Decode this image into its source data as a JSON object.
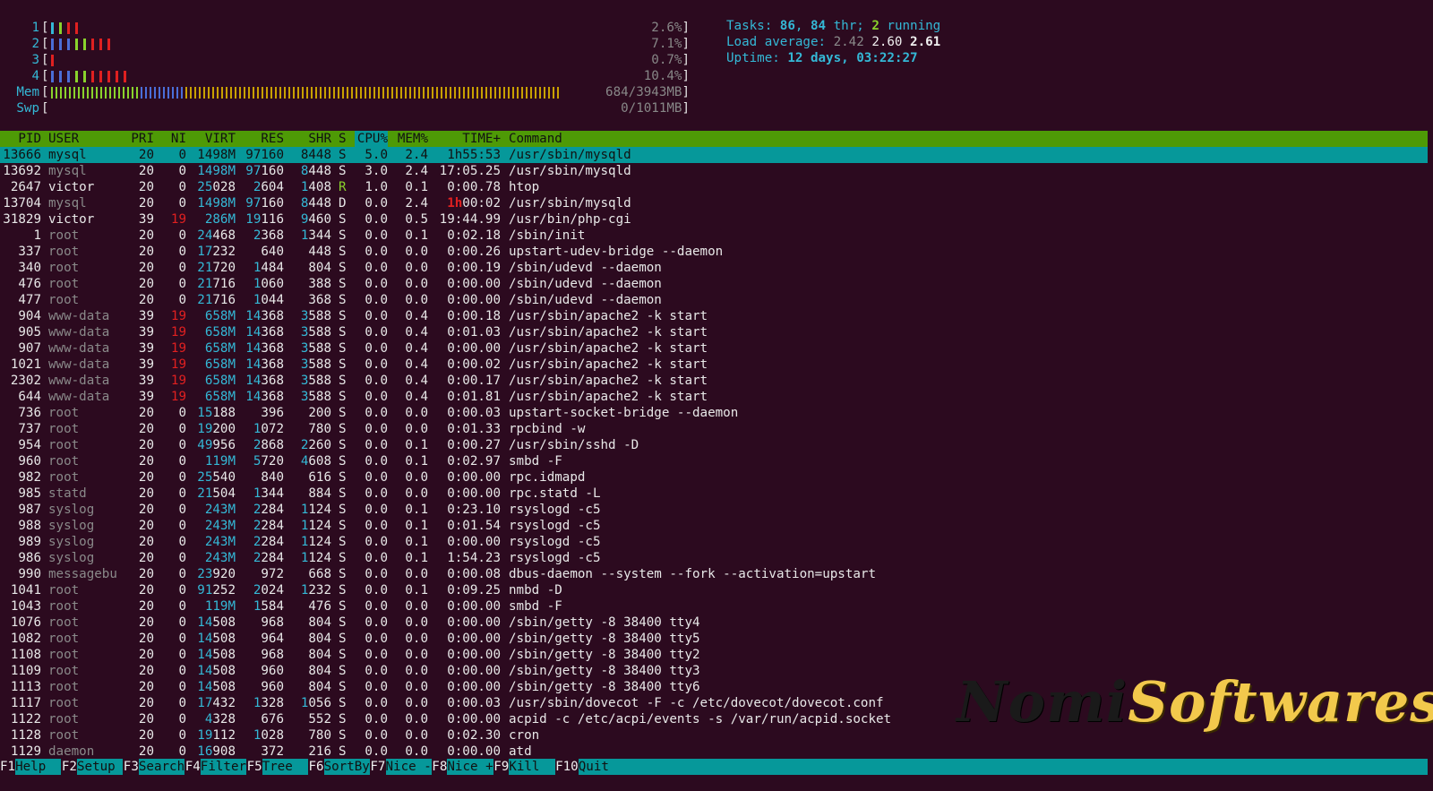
{
  "meters": {
    "cpu": [
      {
        "label": "1",
        "value": "2.6%]",
        "bars": [
          {
            "c": "#34b8d6"
          },
          {
            "c": "#8ad32c"
          },
          {
            "c": "#e02020"
          },
          {
            "c": "#e02020"
          }
        ]
      },
      {
        "label": "2",
        "value": "7.1%]",
        "bars": [
          {
            "c": "#4a6ed8"
          },
          {
            "c": "#4a6ed8"
          },
          {
            "c": "#4a6ed8"
          },
          {
            "c": "#8ad32c"
          },
          {
            "c": "#8ad32c"
          },
          {
            "c": "#e02020"
          },
          {
            "c": "#e02020"
          },
          {
            "c": "#e02020"
          }
        ]
      },
      {
        "label": "3",
        "value": "0.7%]",
        "bars": [
          {
            "c": "#e02020"
          }
        ]
      },
      {
        "label": "4",
        "value": "10.4%]",
        "bars": [
          {
            "c": "#4a6ed8"
          },
          {
            "c": "#4a6ed8"
          },
          {
            "c": "#4a6ed8"
          },
          {
            "c": "#8ad32c"
          },
          {
            "c": "#8ad32c"
          },
          {
            "c": "#e02020"
          },
          {
            "c": "#e02020"
          },
          {
            "c": "#e02020"
          },
          {
            "c": "#e02020"
          },
          {
            "c": "#e02020"
          }
        ]
      }
    ],
    "mem": {
      "label": "Mem",
      "value": "684/3943MB]"
    },
    "swp": {
      "label": "Swp",
      "value": "0/1011MB]"
    }
  },
  "info": {
    "tasks_label": "Tasks: ",
    "tasks": "86",
    "sep1": ", ",
    "thr": "84",
    "thr_label": " thr; ",
    "running": "2",
    "running_label": " running",
    "load_label": "Load average: ",
    "load1": "2.42",
    "load5": "2.60",
    "load15": "2.61",
    "uptime_label": "Uptime: ",
    "uptime": "12 days, 03:22:27"
  },
  "columns": [
    "PID",
    "USER",
    "PRI",
    "NI",
    "VIRT",
    "RES",
    "SHR",
    "S",
    "CPU%",
    "MEM%",
    "TIME+",
    "Command"
  ],
  "processes": [
    [
      "13666",
      "mysql",
      "20",
      "0",
      "1498M",
      "97160",
      "8448",
      "S",
      "5.0",
      "2.4",
      "1h55:53",
      "/usr/sbin/mysqld"
    ],
    [
      "13692",
      "mysql",
      "20",
      "0",
      "1498M",
      "97160",
      "8448",
      "S",
      "3.0",
      "2.4",
      "17:05.25",
      "/usr/sbin/mysqld"
    ],
    [
      "2647",
      "victor",
      "20",
      "0",
      "25028",
      "2604",
      "1408",
      "R",
      "1.0",
      "0.1",
      "0:00.78",
      "htop"
    ],
    [
      "13704",
      "mysql",
      "20",
      "0",
      "1498M",
      "97160",
      "8448",
      "D",
      "0.0",
      "2.4",
      "1h00:02",
      "/usr/sbin/mysqld"
    ],
    [
      "31829",
      "victor",
      "39",
      "19",
      "286M",
      "19116",
      "9460",
      "S",
      "0.0",
      "0.5",
      "19:44.99",
      "/usr/bin/php-cgi"
    ],
    [
      "1",
      "root",
      "20",
      "0",
      "24468",
      "2368",
      "1344",
      "S",
      "0.0",
      "0.1",
      "0:02.18",
      "/sbin/init"
    ],
    [
      "337",
      "root",
      "20",
      "0",
      "17232",
      "640",
      "448",
      "S",
      "0.0",
      "0.0",
      "0:00.26",
      "upstart-udev-bridge --daemon"
    ],
    [
      "340",
      "root",
      "20",
      "0",
      "21720",
      "1484",
      "804",
      "S",
      "0.0",
      "0.0",
      "0:00.19",
      "/sbin/udevd --daemon"
    ],
    [
      "476",
      "root",
      "20",
      "0",
      "21716",
      "1060",
      "388",
      "S",
      "0.0",
      "0.0",
      "0:00.00",
      "/sbin/udevd --daemon"
    ],
    [
      "477",
      "root",
      "20",
      "0",
      "21716",
      "1044",
      "368",
      "S",
      "0.0",
      "0.0",
      "0:00.00",
      "/sbin/udevd --daemon"
    ],
    [
      "904",
      "www-data",
      "39",
      "19",
      "658M",
      "14368",
      "3588",
      "S",
      "0.0",
      "0.4",
      "0:00.18",
      "/usr/sbin/apache2 -k start"
    ],
    [
      "905",
      "www-data",
      "39",
      "19",
      "658M",
      "14368",
      "3588",
      "S",
      "0.0",
      "0.4",
      "0:01.03",
      "/usr/sbin/apache2 -k start"
    ],
    [
      "907",
      "www-data",
      "39",
      "19",
      "658M",
      "14368",
      "3588",
      "S",
      "0.0",
      "0.4",
      "0:00.00",
      "/usr/sbin/apache2 -k start"
    ],
    [
      "1021",
      "www-data",
      "39",
      "19",
      "658M",
      "14368",
      "3588",
      "S",
      "0.0",
      "0.4",
      "0:00.02",
      "/usr/sbin/apache2 -k start"
    ],
    [
      "2302",
      "www-data",
      "39",
      "19",
      "658M",
      "14368",
      "3588",
      "S",
      "0.0",
      "0.4",
      "0:00.17",
      "/usr/sbin/apache2 -k start"
    ],
    [
      "644",
      "www-data",
      "39",
      "19",
      "658M",
      "14368",
      "3588",
      "S",
      "0.0",
      "0.4",
      "0:01.81",
      "/usr/sbin/apache2 -k start"
    ],
    [
      "736",
      "root",
      "20",
      "0",
      "15188",
      "396",
      "200",
      "S",
      "0.0",
      "0.0",
      "0:00.03",
      "upstart-socket-bridge --daemon"
    ],
    [
      "737",
      "root",
      "20",
      "0",
      "19200",
      "1072",
      "780",
      "S",
      "0.0",
      "0.0",
      "0:01.33",
      "rpcbind -w"
    ],
    [
      "954",
      "root",
      "20",
      "0",
      "49956",
      "2868",
      "2260",
      "S",
      "0.0",
      "0.1",
      "0:00.27",
      "/usr/sbin/sshd -D"
    ],
    [
      "960",
      "root",
      "20",
      "0",
      "119M",
      "5720",
      "4608",
      "S",
      "0.0",
      "0.1",
      "0:02.97",
      "smbd -F"
    ],
    [
      "982",
      "root",
      "20",
      "0",
      "25540",
      "840",
      "616",
      "S",
      "0.0",
      "0.0",
      "0:00.00",
      "rpc.idmapd"
    ],
    [
      "985",
      "statd",
      "20",
      "0",
      "21504",
      "1344",
      "884",
      "S",
      "0.0",
      "0.0",
      "0:00.00",
      "rpc.statd -L"
    ],
    [
      "987",
      "syslog",
      "20",
      "0",
      "243M",
      "2284",
      "1124",
      "S",
      "0.0",
      "0.1",
      "0:23.10",
      "rsyslogd -c5"
    ],
    [
      "988",
      "syslog",
      "20",
      "0",
      "243M",
      "2284",
      "1124",
      "S",
      "0.0",
      "0.1",
      "0:01.54",
      "rsyslogd -c5"
    ],
    [
      "989",
      "syslog",
      "20",
      "0",
      "243M",
      "2284",
      "1124",
      "S",
      "0.0",
      "0.1",
      "0:00.00",
      "rsyslogd -c5"
    ],
    [
      "986",
      "syslog",
      "20",
      "0",
      "243M",
      "2284",
      "1124",
      "S",
      "0.0",
      "0.1",
      "1:54.23",
      "rsyslogd -c5"
    ],
    [
      "990",
      "messagebu",
      "20",
      "0",
      "23920",
      "972",
      "668",
      "S",
      "0.0",
      "0.0",
      "0:00.08",
      "dbus-daemon --system --fork --activation=upstart"
    ],
    [
      "1041",
      "root",
      "20",
      "0",
      "91252",
      "2024",
      "1232",
      "S",
      "0.0",
      "0.1",
      "0:09.25",
      "nmbd -D"
    ],
    [
      "1043",
      "root",
      "20",
      "0",
      "119M",
      "1584",
      "476",
      "S",
      "0.0",
      "0.0",
      "0:00.00",
      "smbd -F"
    ],
    [
      "1076",
      "root",
      "20",
      "0",
      "14508",
      "968",
      "804",
      "S",
      "0.0",
      "0.0",
      "0:00.00",
      "/sbin/getty -8 38400 tty4"
    ],
    [
      "1082",
      "root",
      "20",
      "0",
      "14508",
      "964",
      "804",
      "S",
      "0.0",
      "0.0",
      "0:00.00",
      "/sbin/getty -8 38400 tty5"
    ],
    [
      "1108",
      "root",
      "20",
      "0",
      "14508",
      "968",
      "804",
      "S",
      "0.0",
      "0.0",
      "0:00.00",
      "/sbin/getty -8 38400 tty2"
    ],
    [
      "1109",
      "root",
      "20",
      "0",
      "14508",
      "960",
      "804",
      "S",
      "0.0",
      "0.0",
      "0:00.00",
      "/sbin/getty -8 38400 tty3"
    ],
    [
      "1113",
      "root",
      "20",
      "0",
      "14508",
      "960",
      "804",
      "S",
      "0.0",
      "0.0",
      "0:00.00",
      "/sbin/getty -8 38400 tty6"
    ],
    [
      "1117",
      "root",
      "20",
      "0",
      "17432",
      "1328",
      "1056",
      "S",
      "0.0",
      "0.0",
      "0:00.03",
      "/usr/sbin/dovecot -F -c /etc/dovecot/dovecot.conf"
    ],
    [
      "1122",
      "root",
      "20",
      "0",
      "4328",
      "676",
      "552",
      "S",
      "0.0",
      "0.0",
      "0:00.00",
      "acpid -c /etc/acpi/events -s /var/run/acpid.socket"
    ],
    [
      "1128",
      "root",
      "20",
      "0",
      "19112",
      "1028",
      "780",
      "S",
      "0.0",
      "0.0",
      "0:02.30",
      "cron"
    ],
    [
      "1129",
      "daemon",
      "20",
      "0",
      "16908",
      "372",
      "216",
      "S",
      "0.0",
      "0.0",
      "0:00.00",
      "atd"
    ]
  ],
  "footer": [
    {
      "key": "F1",
      "label": "Help  "
    },
    {
      "key": "F2",
      "label": "Setup "
    },
    {
      "key": "F3",
      "label": "Search"
    },
    {
      "key": "F4",
      "label": "Filter"
    },
    {
      "key": "F5",
      "label": "Tree  "
    },
    {
      "key": "F6",
      "label": "SortBy"
    },
    {
      "key": "F7",
      "label": "Nice -"
    },
    {
      "key": "F8",
      "label": "Nice +"
    },
    {
      "key": "F9",
      "label": "Kill  "
    },
    {
      "key": "F10",
      "label": "Quit"
    }
  ],
  "watermark": {
    "part1": "Nomi",
    "part2": "Softwares"
  }
}
